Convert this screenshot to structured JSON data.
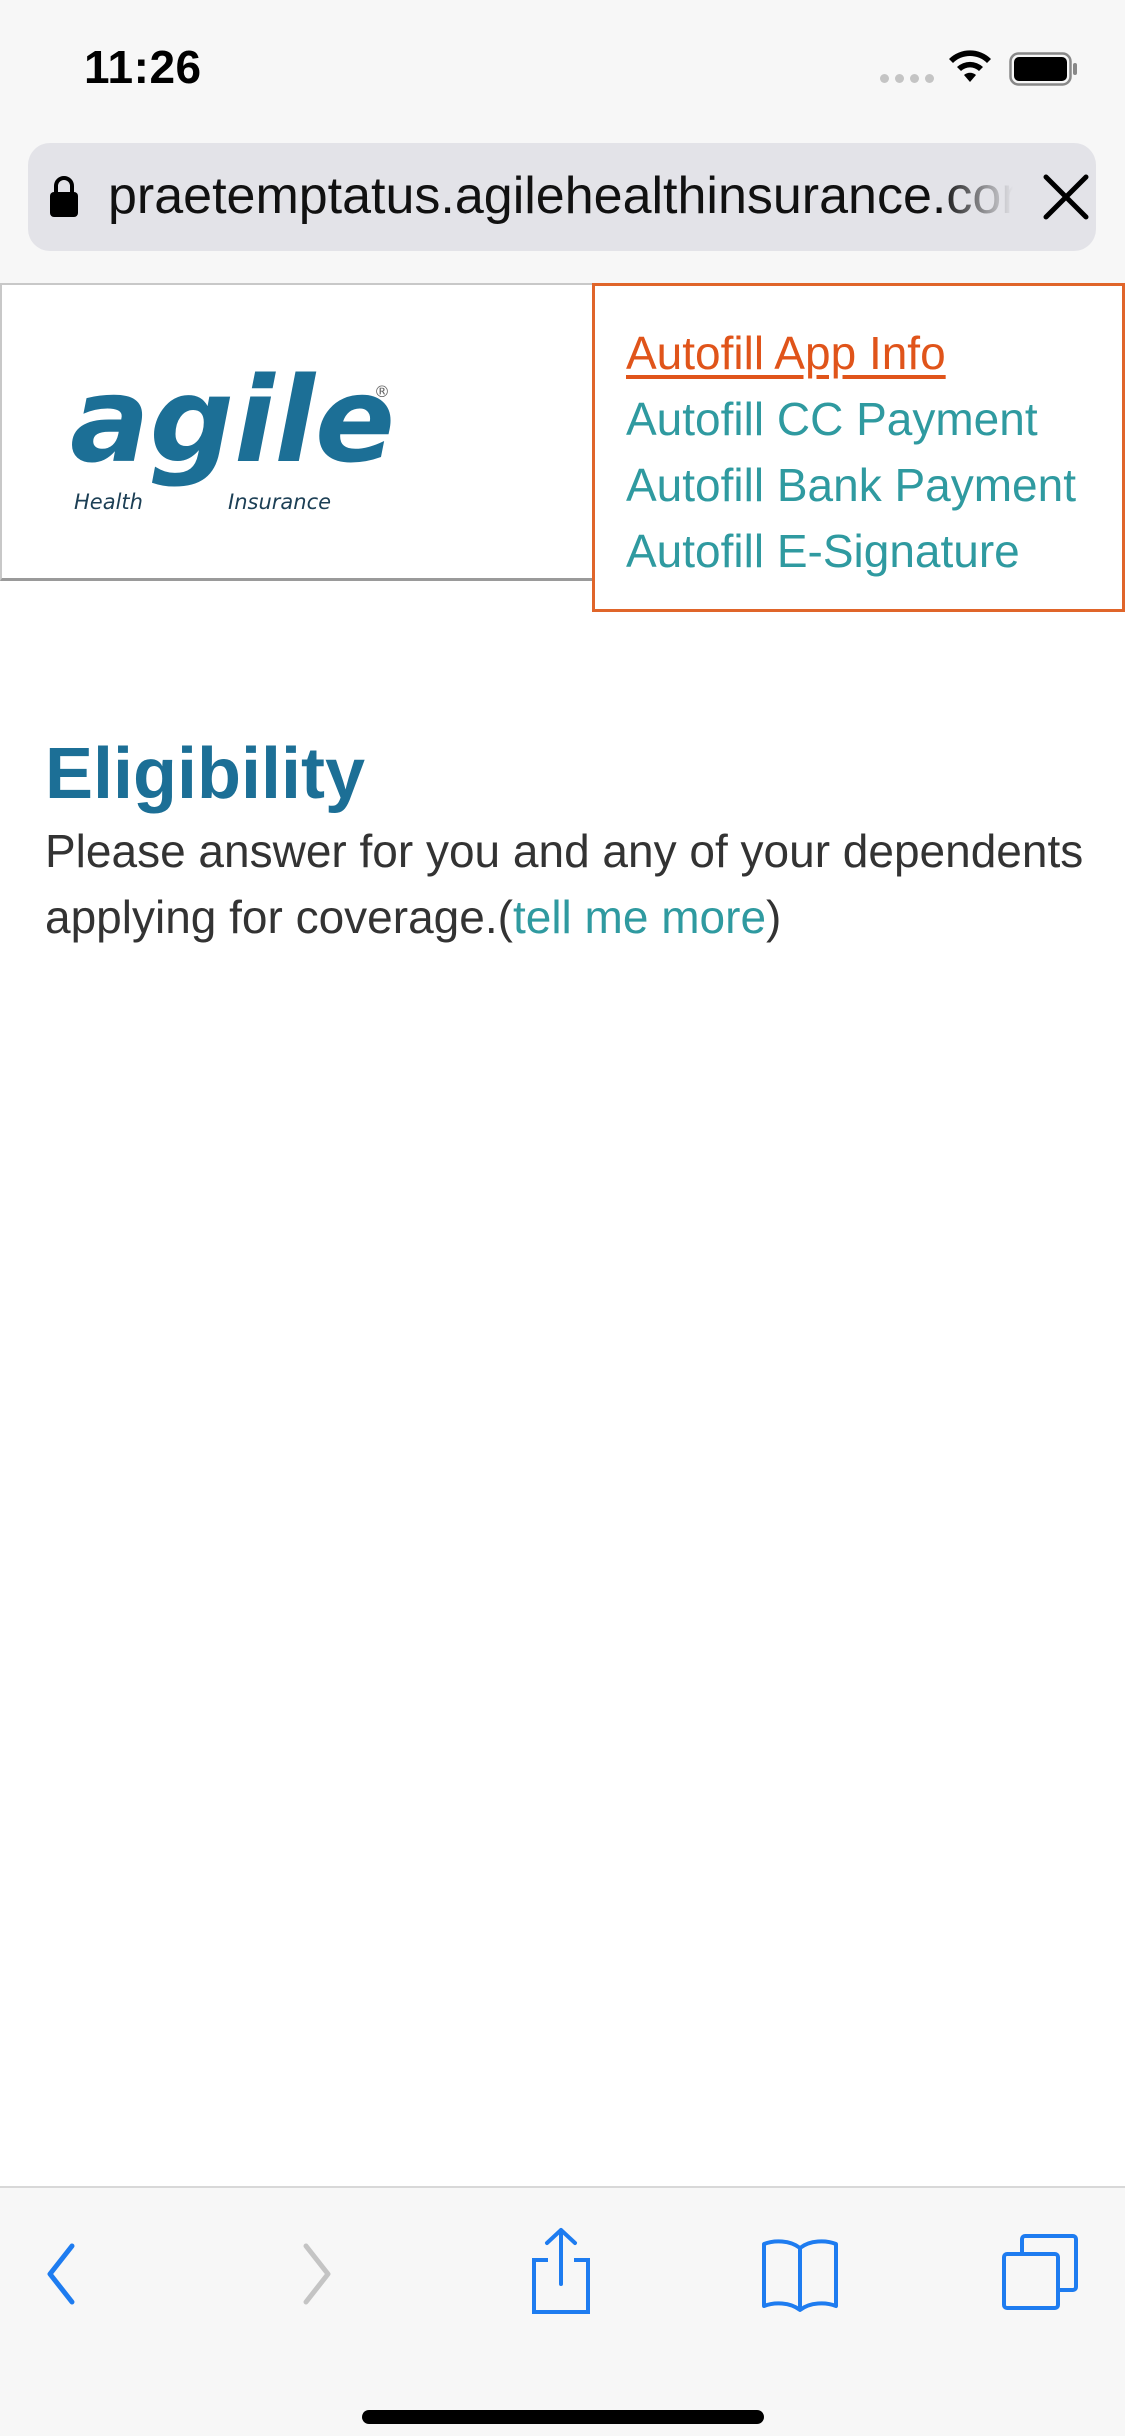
{
  "status_bar": {
    "time": "11:26",
    "icons": [
      "cellular-signal-icon",
      "wifi-icon",
      "battery-icon"
    ]
  },
  "browser": {
    "url": "praetemptatus.agilehealthinsurance.com",
    "icons": [
      "lock-icon",
      "close-icon"
    ]
  },
  "header": {
    "logo": {
      "main": "agile",
      "sub_left": "Health",
      "sub_right": "Insurance",
      "mark": "®"
    },
    "autofill_links": [
      {
        "label": "Autofill App Info",
        "state": "active"
      },
      {
        "label": "Autofill CC Payment",
        "state": "normal"
      },
      {
        "label": "Autofill Bank Payment",
        "state": "normal"
      },
      {
        "label": "Autofill E-Signature",
        "state": "normal"
      }
    ]
  },
  "main": {
    "title": "Eligibility",
    "description": "Please answer for you and any of your dependents applying for coverage.",
    "open_paren": "(",
    "tell_more": "tell me more",
    "close_paren": ")"
  },
  "toolbar": {
    "icons": [
      "back-icon",
      "forward-icon",
      "share-icon",
      "bookmarks-icon",
      "tabs-icon"
    ]
  },
  "colors": {
    "brand_blue": "#1c6f96",
    "link_teal": "#2f9aa0",
    "active_orange": "#e0541a",
    "ios_blue": "#1e7cf0"
  }
}
